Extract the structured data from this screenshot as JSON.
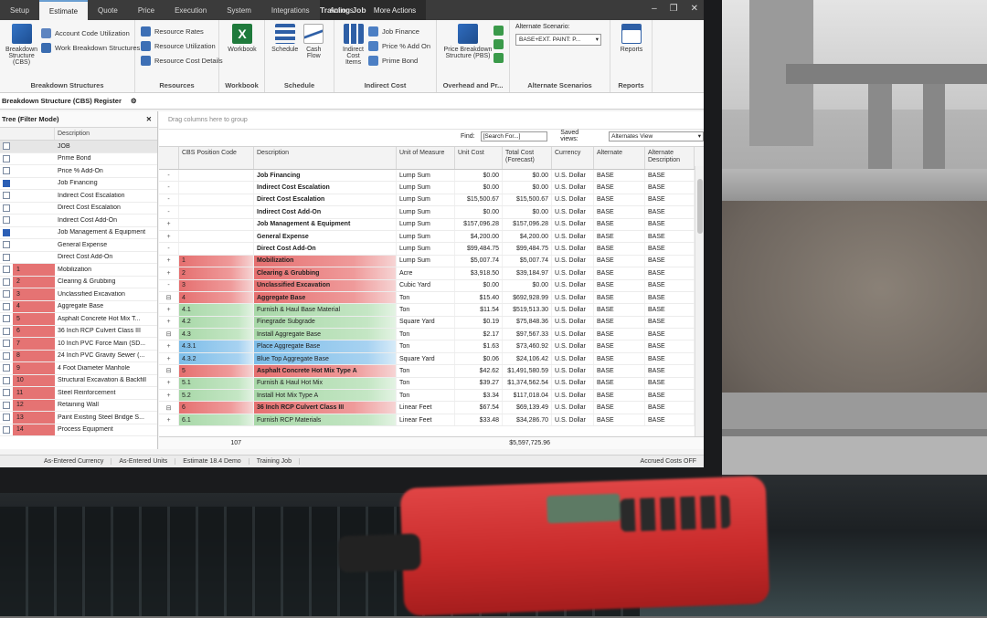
{
  "window": {
    "title": "Training Job"
  },
  "menu_tabs": [
    "Setup",
    "Estimate",
    "Quote",
    "Price",
    "Execution",
    "System",
    "Integrations",
    "Actions",
    "More Actions"
  ],
  "ribbon": {
    "breakdown": {
      "big": "Breakdown Structure (CBS)",
      "items": [
        "Account Code Utilization",
        "Work Breakdown Structures"
      ],
      "label": "Breakdown Structures"
    },
    "resources": {
      "items": [
        "Resource Rates",
        "Resource Utilization",
        "Resource Cost Details"
      ],
      "label": "Resources"
    },
    "workbook": {
      "big": "Workbook",
      "label": "Workbook"
    },
    "schedule": {
      "items": [
        "Schedule",
        "Cash Flow"
      ],
      "label": "Schedule"
    },
    "indirect": {
      "big": "Indirect Cost Items",
      "items": [
        "Job Finance",
        "Price % Add On",
        "Prime Bond"
      ],
      "label": "Indirect Cost"
    },
    "overhead": {
      "big": "Price Breakdown Structure (PBS)",
      "label": "Overhead and Pr..."
    },
    "alternates": {
      "title": "Alternate Scenario:",
      "value": "BASE+EXT. PAINT: P...",
      "label": "Alternate Scenarios"
    },
    "reports": {
      "big": "Reports",
      "label": "Reports"
    }
  },
  "doc_tab": "Breakdown Structure (CBS) Register",
  "tree": {
    "header": "Tree (Filter Mode)",
    "col_desc": "Description",
    "rows": [
      {
        "num": "",
        "desc": "JOB",
        "type": "sel"
      },
      {
        "num": "",
        "desc": "Prime Bond",
        "type": "plain"
      },
      {
        "num": "",
        "desc": "Price % Add-On",
        "type": "plain"
      },
      {
        "num": "",
        "desc": "Job Financing",
        "type": "blue"
      },
      {
        "num": "",
        "desc": "Indirect Cost Escalation",
        "type": "plain"
      },
      {
        "num": "",
        "desc": "Direct Cost Escalation",
        "type": "plain"
      },
      {
        "num": "",
        "desc": "Indirect Cost Add-On",
        "type": "plain"
      },
      {
        "num": "",
        "desc": "Job Management & Equipment",
        "type": "blue"
      },
      {
        "num": "",
        "desc": "General Expense",
        "type": "plain"
      },
      {
        "num": "",
        "desc": "Direct Cost Add-On",
        "type": "plain"
      },
      {
        "num": "1",
        "desc": "Mobilization",
        "type": "red"
      },
      {
        "num": "2",
        "desc": "Clearing & Grubbing",
        "type": "red"
      },
      {
        "num": "3",
        "desc": "Unclassified Excavation",
        "type": "red"
      },
      {
        "num": "4",
        "desc": "Aggregate Base",
        "type": "red"
      },
      {
        "num": "5",
        "desc": "Asphalt Concrete Hot Mix T...",
        "type": "red"
      },
      {
        "num": "6",
        "desc": "36 Inch RCP Culvert Class III",
        "type": "red"
      },
      {
        "num": "7",
        "desc": "10 Inch PVC Force Main (SD...",
        "type": "red"
      },
      {
        "num": "8",
        "desc": "24 Inch PVC Gravity Sewer (...",
        "type": "red"
      },
      {
        "num": "9",
        "desc": "4 Foot Diameter Manhole",
        "type": "red"
      },
      {
        "num": "10",
        "desc": "Structural Excavation & Backfill",
        "type": "red"
      },
      {
        "num": "11",
        "desc": "Steel Reinforcement",
        "type": "red"
      },
      {
        "num": "12",
        "desc": "Retaining Wall",
        "type": "red"
      },
      {
        "num": "13",
        "desc": "Paint Existing Steel Bridge S...",
        "type": "red"
      },
      {
        "num": "14",
        "desc": "Process Equipment",
        "type": "red"
      }
    ]
  },
  "grid": {
    "drag_hint": "Drag columns here to group",
    "find_label": "Find:",
    "find_placeholder": "[Search For...]",
    "saved_views_label": "Saved views:",
    "saved_views_value": "Alternates View",
    "columns": [
      "CBS Position Code",
      "Description",
      "Unit of Measure",
      "Unit Cost",
      "Total Cost (Forecast)",
      "Currency",
      "Alternate",
      "Alternate Description"
    ],
    "rows": [
      {
        "exp": "-",
        "code": "",
        "desc": "Job Financing",
        "uom": "Lump Sum",
        "unit": "$0.00",
        "total": "$0.00",
        "cur": "U.S. Dollar",
        "alt": "BASE",
        "altd": "BASE",
        "style": "bold"
      },
      {
        "exp": "-",
        "code": "",
        "desc": "Indirect Cost Escalation",
        "uom": "Lump Sum",
        "unit": "$0.00",
        "total": "$0.00",
        "cur": "U.S. Dollar",
        "alt": "BASE",
        "altd": "BASE",
        "style": "bold"
      },
      {
        "exp": "-",
        "code": "",
        "desc": "Direct Cost Escalation",
        "uom": "Lump Sum",
        "unit": "$15,500.67",
        "total": "$15,500.67",
        "cur": "U.S. Dollar",
        "alt": "BASE",
        "altd": "BASE",
        "style": "bold"
      },
      {
        "exp": "-",
        "code": "",
        "desc": "Indirect Cost Add-On",
        "uom": "Lump Sum",
        "unit": "$0.00",
        "total": "$0.00",
        "cur": "U.S. Dollar",
        "alt": "BASE",
        "altd": "BASE",
        "style": "bold"
      },
      {
        "exp": "+",
        "code": "",
        "desc": "Job Management & Equipment",
        "uom": "Lump Sum",
        "unit": "$157,096.28",
        "total": "$157,096.28",
        "cur": "U.S. Dollar",
        "alt": "BASE",
        "altd": "BASE",
        "style": "bold"
      },
      {
        "exp": "+",
        "code": "",
        "desc": "General Expense",
        "uom": "Lump Sum",
        "unit": "$4,200.00",
        "total": "$4,200.00",
        "cur": "U.S. Dollar",
        "alt": "BASE",
        "altd": "BASE",
        "style": "bold"
      },
      {
        "exp": "-",
        "code": "",
        "desc": "Direct Cost Add-On",
        "uom": "Lump Sum",
        "unit": "$99,484.75",
        "total": "$99,484.75",
        "cur": "U.S. Dollar",
        "alt": "BASE",
        "altd": "BASE",
        "style": "bold"
      },
      {
        "exp": "+",
        "code": "1",
        "desc": "Mobilization",
        "uom": "Lump Sum",
        "unit": "$5,007.74",
        "total": "$5,007.74",
        "cur": "U.S. Dollar",
        "alt": "BASE",
        "altd": "BASE",
        "style": "bold red"
      },
      {
        "exp": "+",
        "code": "2",
        "desc": "Clearing & Grubbing",
        "uom": "Acre",
        "unit": "$3,918.50",
        "total": "$39,184.97",
        "cur": "U.S. Dollar",
        "alt": "BASE",
        "altd": "BASE",
        "style": "bold red"
      },
      {
        "exp": "-",
        "code": "3",
        "desc": "Unclassified Excavation",
        "uom": "Cubic Yard",
        "unit": "$0.00",
        "total": "$0.00",
        "cur": "U.S. Dollar",
        "alt": "BASE",
        "altd": "BASE",
        "style": "bold red"
      },
      {
        "exp": "⊟",
        "code": "4",
        "desc": "Aggregate Base",
        "uom": "Ton",
        "unit": "$15.40",
        "total": "$692,928.99",
        "cur": "U.S. Dollar",
        "alt": "BASE",
        "altd": "BASE",
        "style": "bold red"
      },
      {
        "exp": "+",
        "code": "4.1",
        "desc": "Furnish & Haul Base Material",
        "uom": "Ton",
        "unit": "$11.54",
        "total": "$519,513.30",
        "cur": "U.S. Dollar",
        "alt": "BASE",
        "altd": "BASE",
        "style": "green"
      },
      {
        "exp": "+",
        "code": "4.2",
        "desc": "Finegrade Subgrade",
        "uom": "Square Yard",
        "unit": "$0.19",
        "total": "$75,848.36",
        "cur": "U.S. Dollar",
        "alt": "BASE",
        "altd": "BASE",
        "style": "green"
      },
      {
        "exp": "⊟",
        "code": "4.3",
        "desc": "Install Aggregate Base",
        "uom": "Ton",
        "unit": "$2.17",
        "total": "$97,567.33",
        "cur": "U.S. Dollar",
        "alt": "BASE",
        "altd": "BASE",
        "style": "green"
      },
      {
        "exp": "+",
        "code": "4.3.1",
        "desc": "Place Aggregate Base",
        "uom": "Ton",
        "unit": "$1.63",
        "total": "$73,460.92",
        "cur": "U.S. Dollar",
        "alt": "BASE",
        "altd": "BASE",
        "style": "blue"
      },
      {
        "exp": "+",
        "code": "4.3.2",
        "desc": "Blue Top Aggregate Base",
        "uom": "Square Yard",
        "unit": "$0.06",
        "total": "$24,106.42",
        "cur": "U.S. Dollar",
        "alt": "BASE",
        "altd": "BASE",
        "style": "blue"
      },
      {
        "exp": "⊟",
        "code": "5",
        "desc": "Asphalt Concrete Hot Mix Type A",
        "uom": "Ton",
        "unit": "$42.62",
        "total": "$1,491,580.59",
        "cur": "U.S. Dollar",
        "alt": "BASE",
        "altd": "BASE",
        "style": "bold red"
      },
      {
        "exp": "+",
        "code": "5.1",
        "desc": "Furnish & Haul Hot Mix",
        "uom": "Ton",
        "unit": "$39.27",
        "total": "$1,374,562.54",
        "cur": "U.S. Dollar",
        "alt": "BASE",
        "altd": "BASE",
        "style": "green"
      },
      {
        "exp": "+",
        "code": "5.2",
        "desc": "Install Hot Mix Type A",
        "uom": "Ton",
        "unit": "$3.34",
        "total": "$117,018.04",
        "cur": "U.S. Dollar",
        "alt": "BASE",
        "altd": "BASE",
        "style": "green"
      },
      {
        "exp": "⊟",
        "code": "6",
        "desc": "36 Inch RCP Culvert Class III",
        "uom": "Linear Feet",
        "unit": "$67.54",
        "total": "$69,139.49",
        "cur": "U.S. Dollar",
        "alt": "BASE",
        "altd": "BASE",
        "style": "bold red"
      },
      {
        "exp": "+",
        "code": "6.1",
        "desc": "Furnish RCP Materials",
        "uom": "Linear Feet",
        "unit": "$33.48",
        "total": "$34,286.70",
        "cur": "U.S. Dollar",
        "alt": "BASE",
        "altd": "BASE",
        "style": "green"
      }
    ],
    "footer_count": "107",
    "footer_total": "$5,597,725.96"
  },
  "status": [
    "As-Entered Currency",
    "As-Entered Units",
    "Estimate 18.4 Demo",
    "Training Job",
    "Accrued Costs OFF"
  ]
}
